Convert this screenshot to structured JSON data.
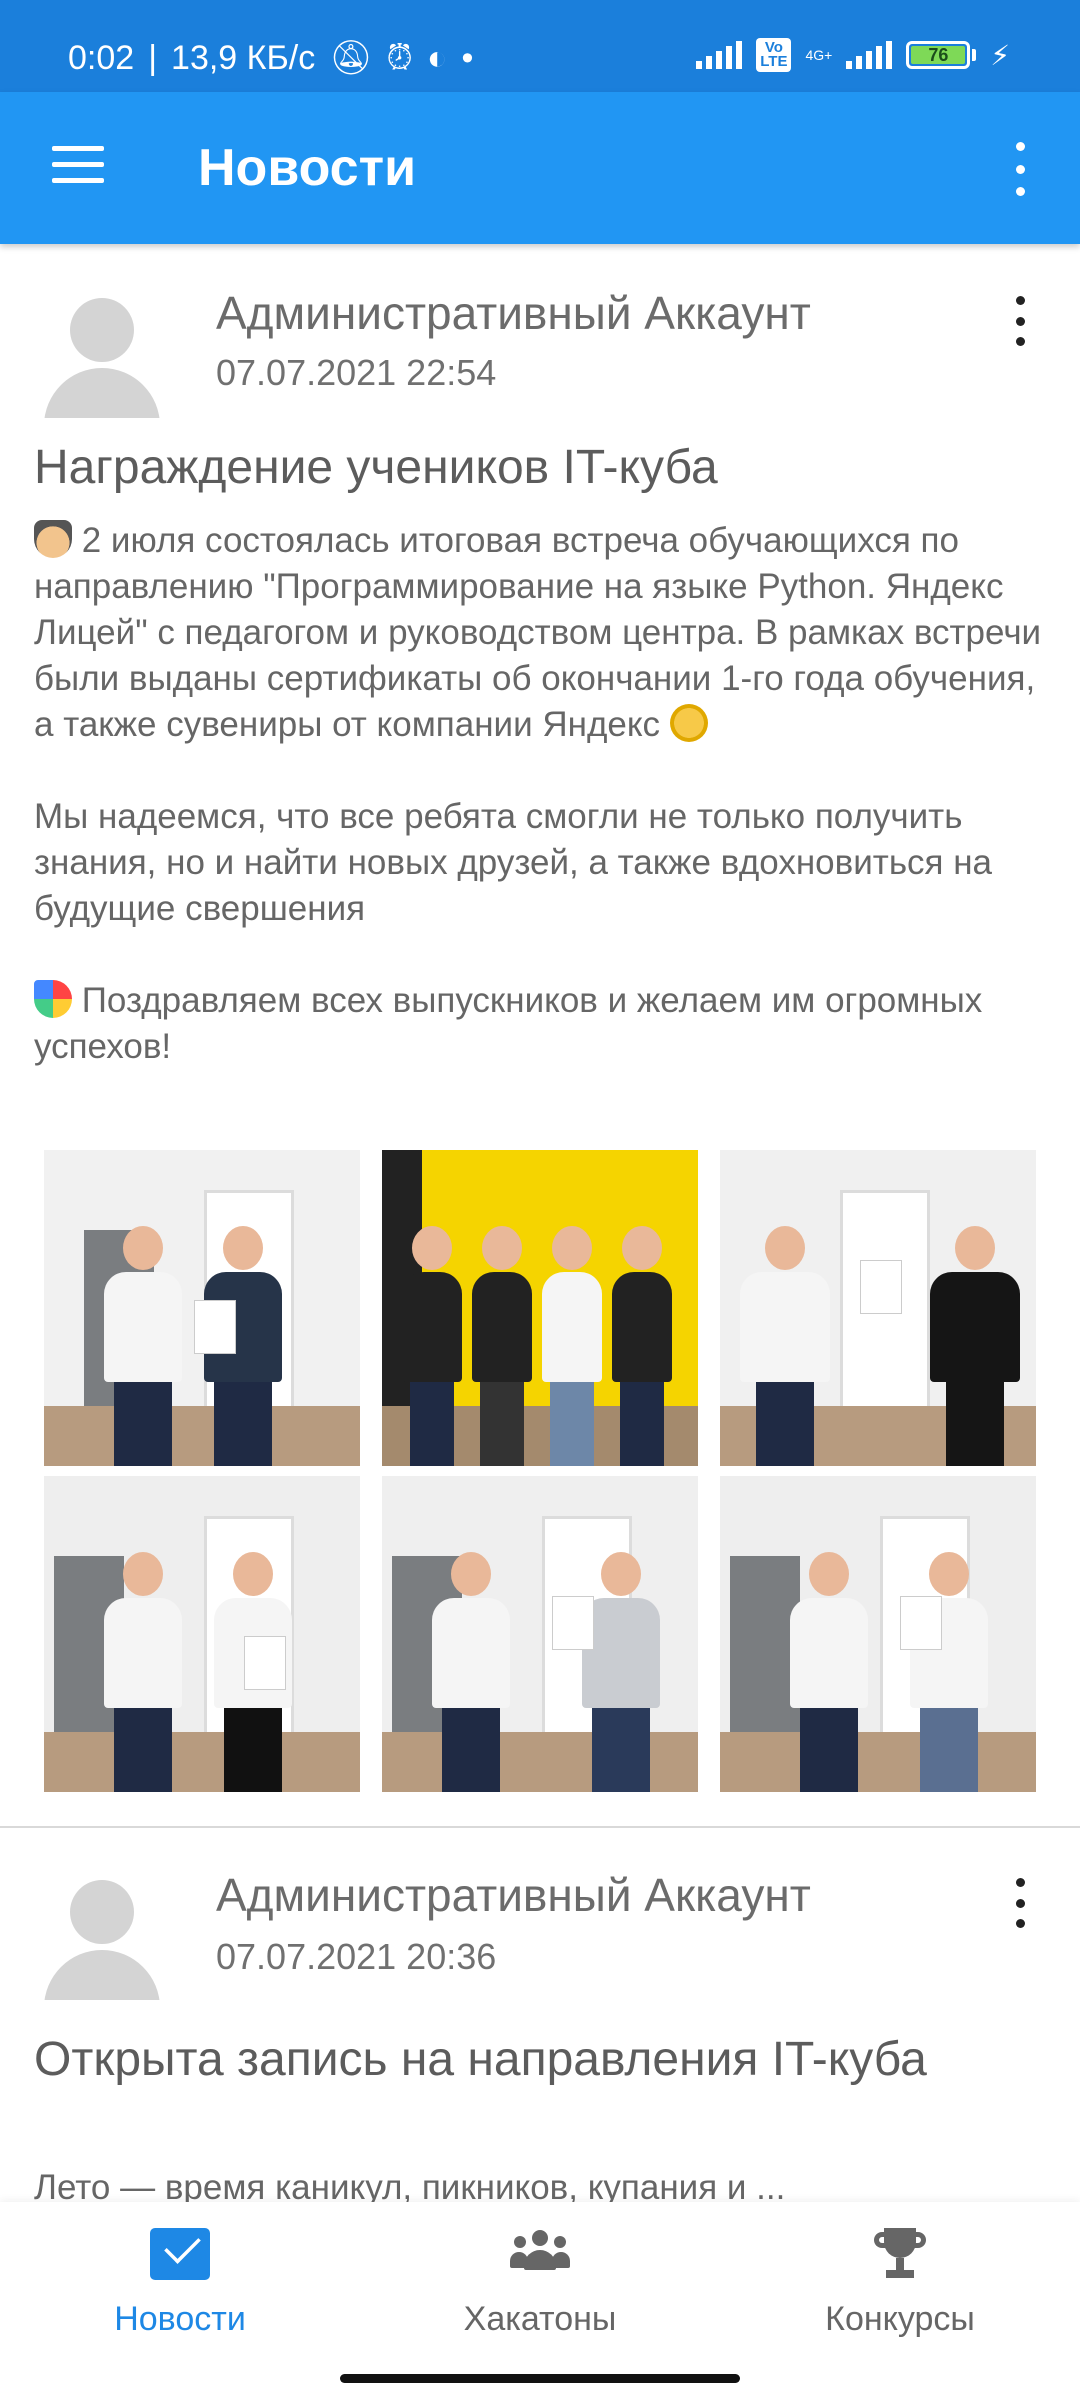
{
  "status_bar": {
    "time": "0:02",
    "speed": "13,9 КБ/с",
    "network": "4G+",
    "volte": "Vo LTE",
    "battery_level": "76"
  },
  "app_bar": {
    "title": "Новости"
  },
  "posts": [
    {
      "author": "Административный Аккаунт",
      "date": "07.07.2021 22:54",
      "title": "Награждение учеников IT-куба",
      "body_p1": " 2 июля состоялась итоговая встреча обучающихся по направлению \"Программирование на языке Python. Яндекс Лицей\" с педагогом и руководством центра. В рамках встречи были выданы сертификаты об окончании 1-го года обучения, а также сувениры от компании Яндекс ",
      "body_p2": "Мы надеемся, что все ребята смогли не только получить знания, но и найти новых друзей, а также вдохновиться на будущие свершения",
      "body_p3": " Поздравляем всех выпускников и желаем им огромных успехов!",
      "emoji_1": "student-emoji",
      "emoji_2": "medal-emoji",
      "emoji_3": "party-popper-emoji",
      "photos": [
        {
          "scene": "office-handshake",
          "wall": "#f1f1f1"
        },
        {
          "scene": "yandex-lyceum-group",
          "wall": "#f5d400"
        },
        {
          "scene": "office-handshake",
          "wall": "#f0f0f0"
        },
        {
          "scene": "office-handshake",
          "wall": "#eeeeee"
        },
        {
          "scene": "office-handshake",
          "wall": "#efefef"
        },
        {
          "scene": "office-handshake",
          "wall": "#eeeeee"
        }
      ]
    },
    {
      "author": "Административный Аккаунт",
      "date": "07.07.2021 20:36",
      "title": "Открыта запись на направления IT-куба",
      "excerpt": "Лето — время каникул, пикников, купания и ..."
    }
  ],
  "bottom_nav": [
    {
      "label": "Новости",
      "icon": "mail-icon",
      "active": true
    },
    {
      "label": "Хакатоны",
      "icon": "group-icon",
      "active": false
    },
    {
      "label": "Конкурсы",
      "icon": "trophy-icon",
      "active": false
    }
  ],
  "colors": {
    "status_bar": "#1b7fdb",
    "app_bar": "#2196f3",
    "accent": "#1e88e5"
  }
}
